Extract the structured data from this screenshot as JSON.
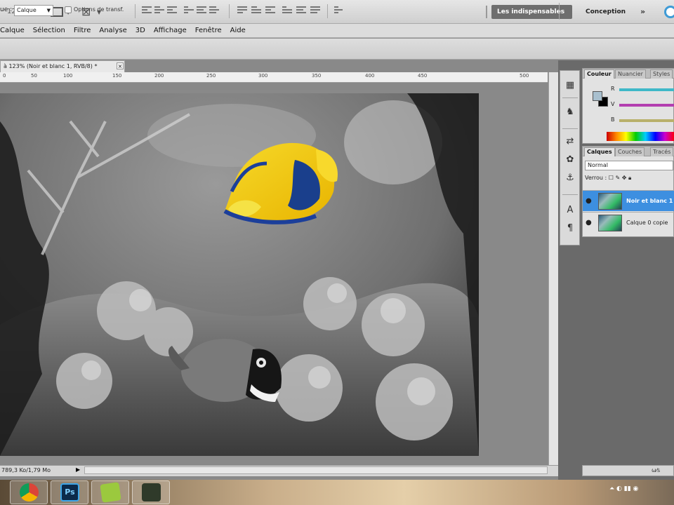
{
  "appbar": {
    "zoom_value": "123%",
    "workspace_active": "Les indispensables",
    "workspace_other": "Conception",
    "workspace_more": "»"
  },
  "menu": [
    "Calque",
    "Sélection",
    "Filtre",
    "Analyse",
    "3D",
    "Affichage",
    "Fenêtre",
    "Aide"
  ],
  "options": {
    "label": "ue :",
    "select_value": "Calque",
    "checkbox_label": "Options de transf."
  },
  "document": {
    "tab_title": "à 123% (Noir et blanc 1, RVB/8) *",
    "tab_close": "×",
    "ruler_ticks": [
      "0",
      "50",
      "100",
      "150",
      "200",
      "250",
      "300",
      "350",
      "400",
      "450",
      "500"
    ],
    "status_text": "789,3 Ko/1,79 Mo",
    "status_arrow": "▶"
  },
  "color_panel": {
    "tabs": [
      "Couleur",
      "Nuancier",
      "Styles"
    ],
    "labels": [
      "R",
      "V",
      "B"
    ],
    "fg_color": "#a9c0cf",
    "bg_color": "#000000",
    "slider_colors": [
      "#3fb8c8",
      "#b33fb0",
      "#b8b06a"
    ]
  },
  "layers_panel": {
    "tabs": [
      "Calques",
      "Couches",
      "Tracés"
    ],
    "blend_mode": "Normal",
    "lock_label": "Verrou :",
    "layers": [
      {
        "name": "Noir et blanc 1",
        "selected": true
      },
      {
        "name": "Calque 0 copie",
        "selected": false
      }
    ],
    "bottom_text": "ω⁄s"
  },
  "taskbar": {
    "apps": [
      "chrome-icon",
      "photoshop-icon",
      "notes-icon",
      "media-icon"
    ],
    "ps_label": "Ps"
  }
}
